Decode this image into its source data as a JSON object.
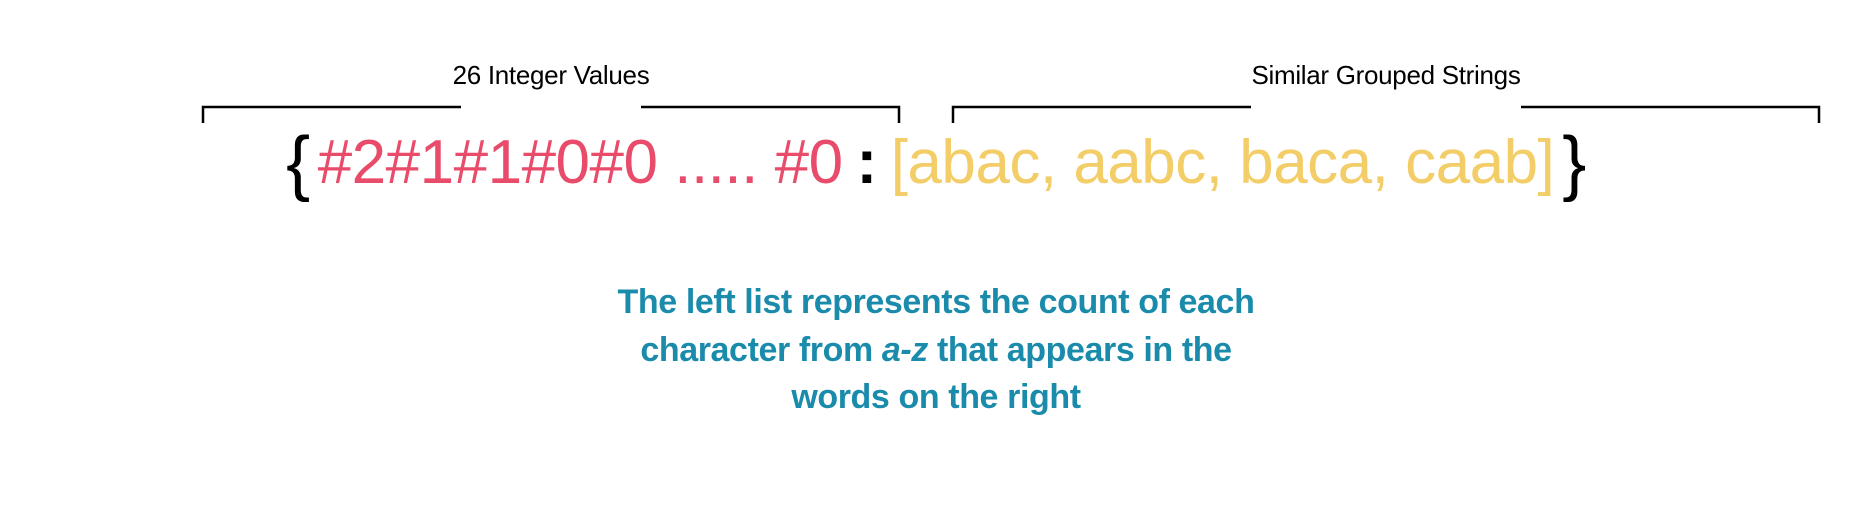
{
  "labels": {
    "left": "26 Integer Values",
    "right": "Similar Grouped Strings"
  },
  "expression": {
    "open_brace": "{",
    "key": "#2#1#1#0#0 ..... #0",
    "colon": ":",
    "value": "[abac, aabc, baca, caab]",
    "close_brace": "}"
  },
  "caption": {
    "line1_a": "The left list represents the count of each",
    "line2_a": "character from ",
    "line2_italic": "a-z",
    "line2_b": " that appears in the",
    "line3": "words on the right"
  },
  "colors": {
    "key": "#e94b6a",
    "value": "#f3ce68",
    "caption": "#1a8bab",
    "brace": "#000000"
  }
}
